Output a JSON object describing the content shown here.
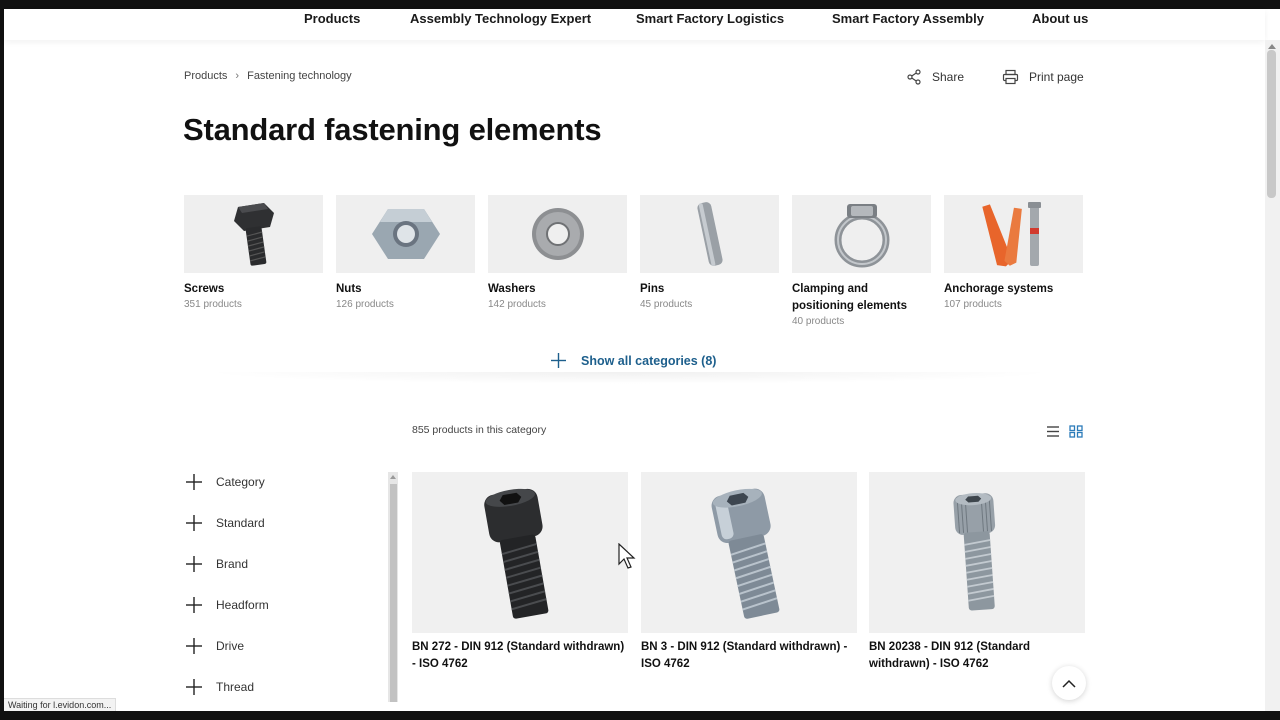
{
  "nav": {
    "items": [
      {
        "label": "Products"
      },
      {
        "label": "Assembly Technology Expert"
      },
      {
        "label": "Smart Factory Logistics"
      },
      {
        "label": "Smart Factory Assembly"
      },
      {
        "label": "About us"
      }
    ]
  },
  "breadcrumb": {
    "items": [
      "Products",
      "Fastening technology"
    ],
    "separator": "›"
  },
  "actions": {
    "share": "Share",
    "print": "Print page"
  },
  "page_title": "Standard fastening elements",
  "categories": [
    {
      "name": "Screws",
      "count": "351 products",
      "icon": "screw-image"
    },
    {
      "name": "Nuts",
      "count": "126 products",
      "icon": "nut-image"
    },
    {
      "name": "Washers",
      "count": "142 products",
      "icon": "washer-image"
    },
    {
      "name": "Pins",
      "count": "45 products",
      "icon": "pin-image"
    },
    {
      "name": "Clamping and positioning elements",
      "count": "40 products",
      "icon": "hose-clamp-image"
    },
    {
      "name": "Anchorage systems",
      "count": "107 products",
      "icon": "anchor-image"
    }
  ],
  "show_all": "Show all categories (8)",
  "product_count": "855 products in this category",
  "filters": [
    "Category",
    "Standard",
    "Brand",
    "Headform",
    "Drive",
    "Thread"
  ],
  "products": [
    {
      "title": "BN 272 - DIN 912 (Standard withdrawn) - ISO 4762",
      "finish": "black"
    },
    {
      "title": "BN 3 - DIN 912 (Standard withdrawn) - ISO 4762",
      "finish": "zinc-blue"
    },
    {
      "title": "BN 20238 - DIN 912 (Standard withdrawn) - ISO 4762",
      "finish": "zinc"
    }
  ],
  "status_bar": "Waiting for l.evidon.com...",
  "colors": {
    "accent": "#1d5f8c",
    "grid_icon": "#2b7bb9"
  }
}
